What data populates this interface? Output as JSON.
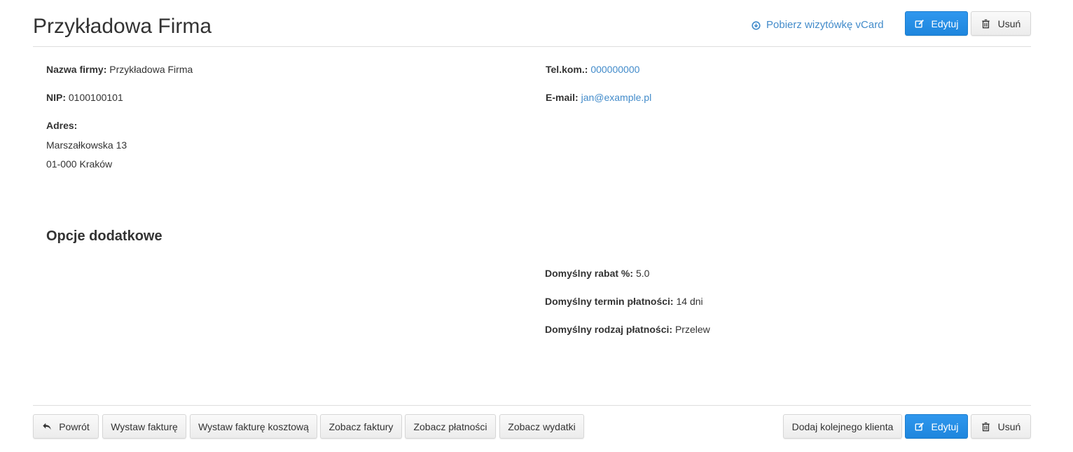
{
  "header": {
    "title": "Przykładowa Firma",
    "vcard_label": "Pobierz wizytówkę vCard",
    "edit_label": "Edytuj",
    "delete_label": "Usuń"
  },
  "details": {
    "company_name_label": "Nazwa firmy:",
    "company_name": "Przykładowa Firma",
    "nip_label": "NIP:",
    "nip": "0100100101",
    "address_label": "Adres:",
    "address_line1": "Marszałkowska 13",
    "address_line2": "01-000 Kraków",
    "phone_label": "Tel.kom.:",
    "phone": "000000000",
    "email_label": "E-mail:",
    "email": "jan@example.pl"
  },
  "options": {
    "title": "Opcje dodatkowe",
    "discount_label": "Domyślny rabat %:",
    "discount": "5.0",
    "term_label": "Domyślny termin płatności:",
    "term": "14 dni",
    "payment_type_label": "Domyślny rodzaj płatności:",
    "payment_type": "Przelew"
  },
  "footer": {
    "back_label": "Powrót",
    "invoice_label": "Wystaw fakturę",
    "cost_invoice_label": "Wystaw fakturę kosztową",
    "view_invoices_label": "Zobacz faktury",
    "view_payments_label": "Zobacz płatności",
    "view_expenses_label": "Zobacz wydatki",
    "add_client_label": "Dodaj kolejnego klienta",
    "edit_label": "Edytuj",
    "delete_label": "Usuń"
  },
  "colors": {
    "link": "#428bca",
    "primary": "#2a8fe6"
  }
}
